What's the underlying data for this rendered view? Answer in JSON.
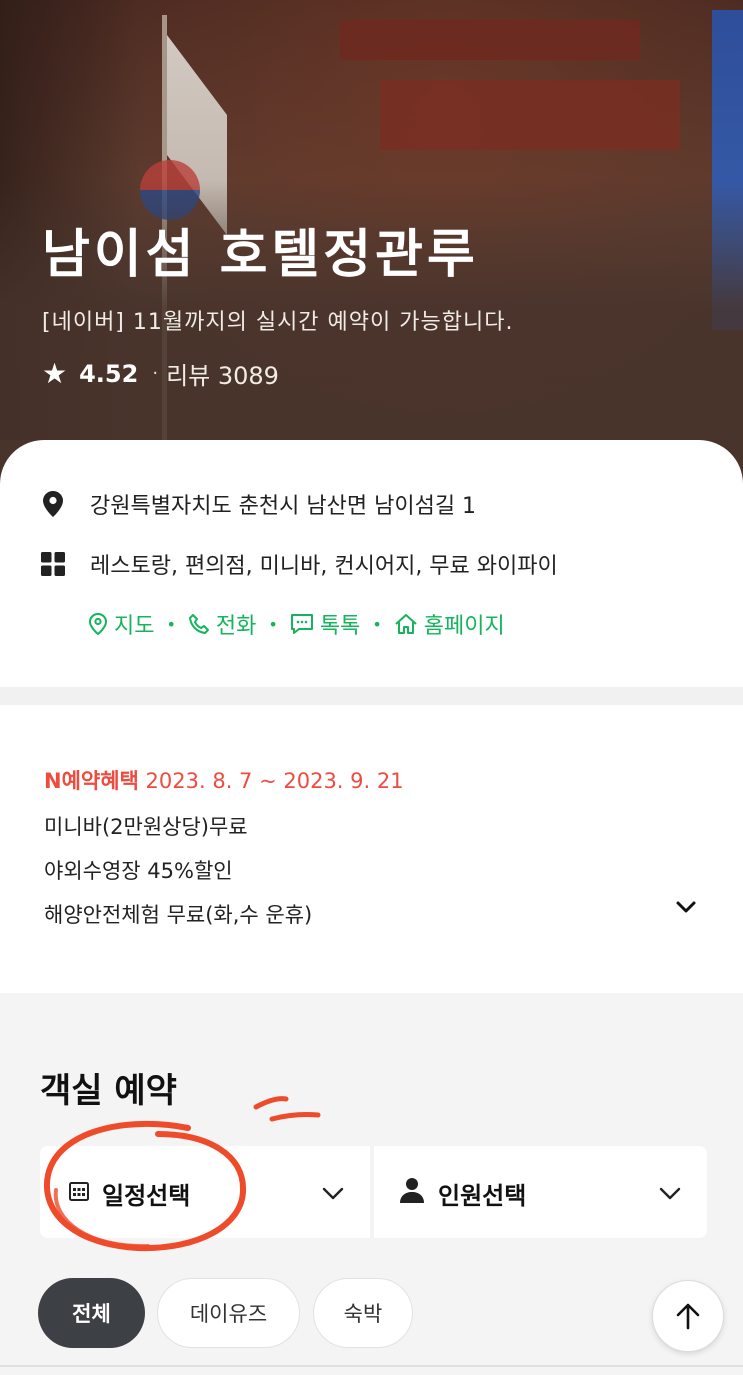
{
  "hero": {
    "title": "남이섬 호텔정관루",
    "subtitle": "[네이버] 11월까지의 실시간 예약이 가능합니다.",
    "rating": "4.52",
    "reviews": "리뷰 3089"
  },
  "info": {
    "address": "강원특별자치도 춘천시 남산면 남이섬길 1",
    "facilities": "레스토랑, 편의점, 미니바, 컨시어지, 무료 와이파이",
    "links": [
      {
        "label": "지도",
        "icon": "map-pin-icon"
      },
      {
        "label": "전화",
        "icon": "phone-icon"
      },
      {
        "label": "톡톡",
        "icon": "chat-icon"
      },
      {
        "label": "홈페이지",
        "icon": "home-icon"
      }
    ]
  },
  "benefit": {
    "badge": "N예약혜택",
    "period": "2023. 8. 7 ~ 2023. 9. 21",
    "items": [
      "미니바(2만원상당)무료",
      "야외수영장 45%할인",
      "해양안전체험 무료(화,수 운휴)"
    ]
  },
  "booking": {
    "title": "객실 예약",
    "date_select": "일정선택",
    "person_select": "인원선택",
    "filters": [
      "전체",
      "데이유즈",
      "숙박"
    ]
  },
  "colors": {
    "accent_green": "#16b45c",
    "benefit_red": "#ef4b3f",
    "annotation_red": "#ee4b2b"
  }
}
